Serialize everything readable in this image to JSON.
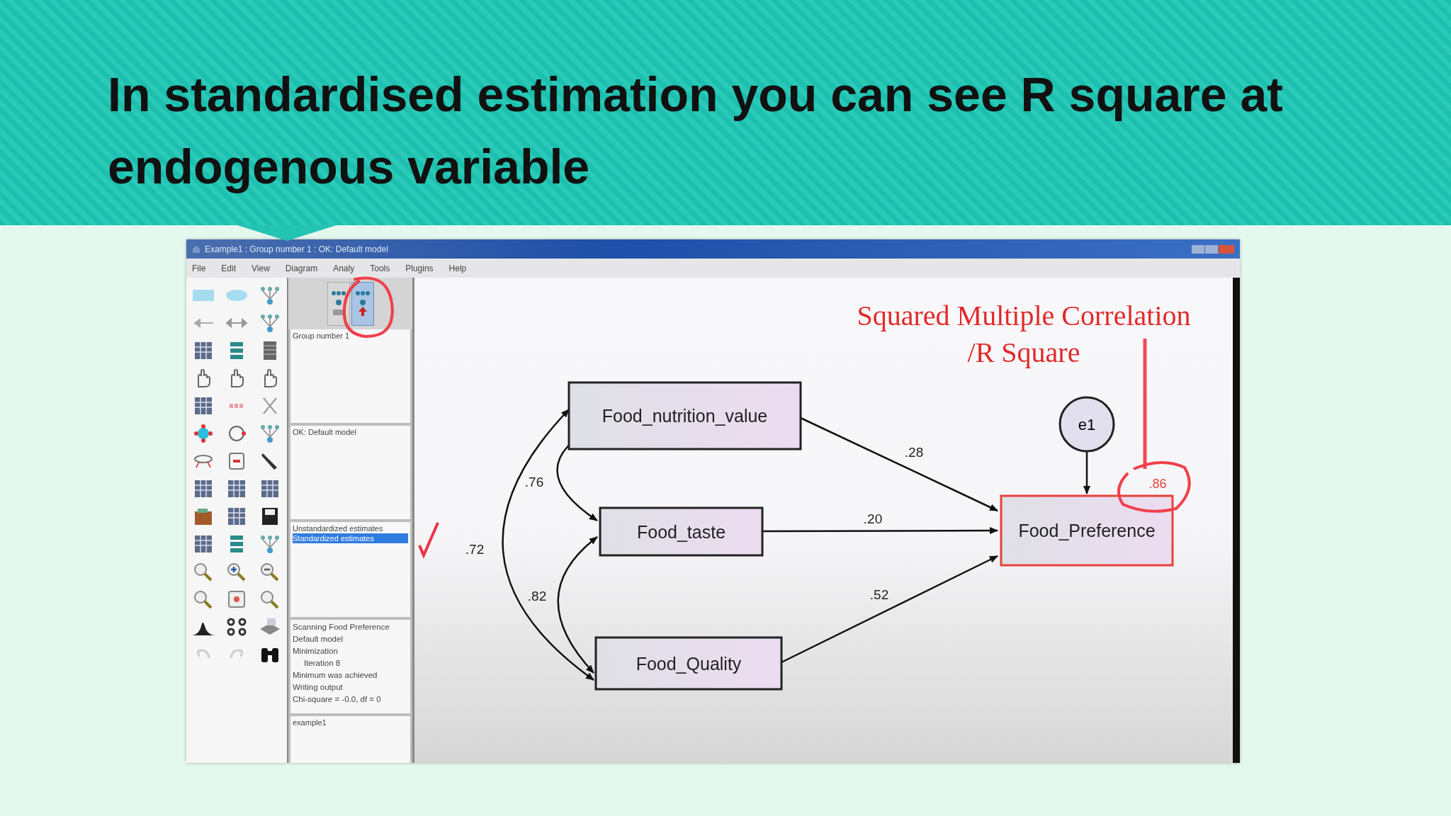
{
  "slide_title": "In standardised estimation you can see R square at endogenous variable",
  "window": {
    "title": "Example1 : Group number 1 : OK: Default model"
  },
  "menu": [
    "File",
    "Edit",
    "View",
    "Diagram",
    "Analy",
    "Tools",
    "Plugins",
    "Help"
  ],
  "panel": {
    "view_buttons": [
      {
        "selected": false
      },
      {
        "selected": true
      }
    ],
    "groups": [
      "Group number 1"
    ],
    "models": [
      "OK: Default model"
    ],
    "estimates": [
      {
        "label": "Unstandardized estimates",
        "selected": false
      },
      {
        "label": "Standardized estimates",
        "selected": true
      }
    ],
    "log": [
      {
        "text": "Scanning Food Preference",
        "kind": "line"
      },
      {
        "text": "Default model",
        "kind": "line"
      },
      {
        "text": "Minimization",
        "kind": "line"
      },
      {
        "text": "Iteration 8",
        "kind": "detail"
      },
      {
        "text": "Minimum was achieved",
        "kind": "line"
      },
      {
        "text": "Writing output",
        "kind": "line"
      },
      {
        "text": "Chi-square = -0.0, df = 0",
        "kind": "line"
      }
    ],
    "files": [
      "example1"
    ]
  },
  "diagram": {
    "nodes": [
      {
        "label": "Food_nutrition_value",
        "kind": "observed",
        "highlighted": false
      },
      {
        "label": "e1",
        "kind": "error",
        "highlighted": false
      },
      {
        "label": "Food_taste",
        "kind": "observed",
        "highlighted": false
      },
      {
        "label": "Food_Preference",
        "kind": "observed",
        "highlighted": true
      },
      {
        "label": "Food_Quality",
        "kind": "observed",
        "highlighted": false
      }
    ],
    "paths": [
      {
        "kind": "regression",
        "label": ".28"
      },
      {
        "kind": "regression",
        "label": ".20"
      },
      {
        "kind": "regression",
        "label": ".52"
      },
      {
        "kind": "covariance",
        "label": ".76"
      },
      {
        "kind": "covariance",
        "label": ".82"
      },
      {
        "kind": "covariance",
        "label": ".72"
      }
    ],
    "r_square": ".86",
    "annotation": [
      "Squared Multiple Correlation",
      "/R Square"
    ]
  }
}
